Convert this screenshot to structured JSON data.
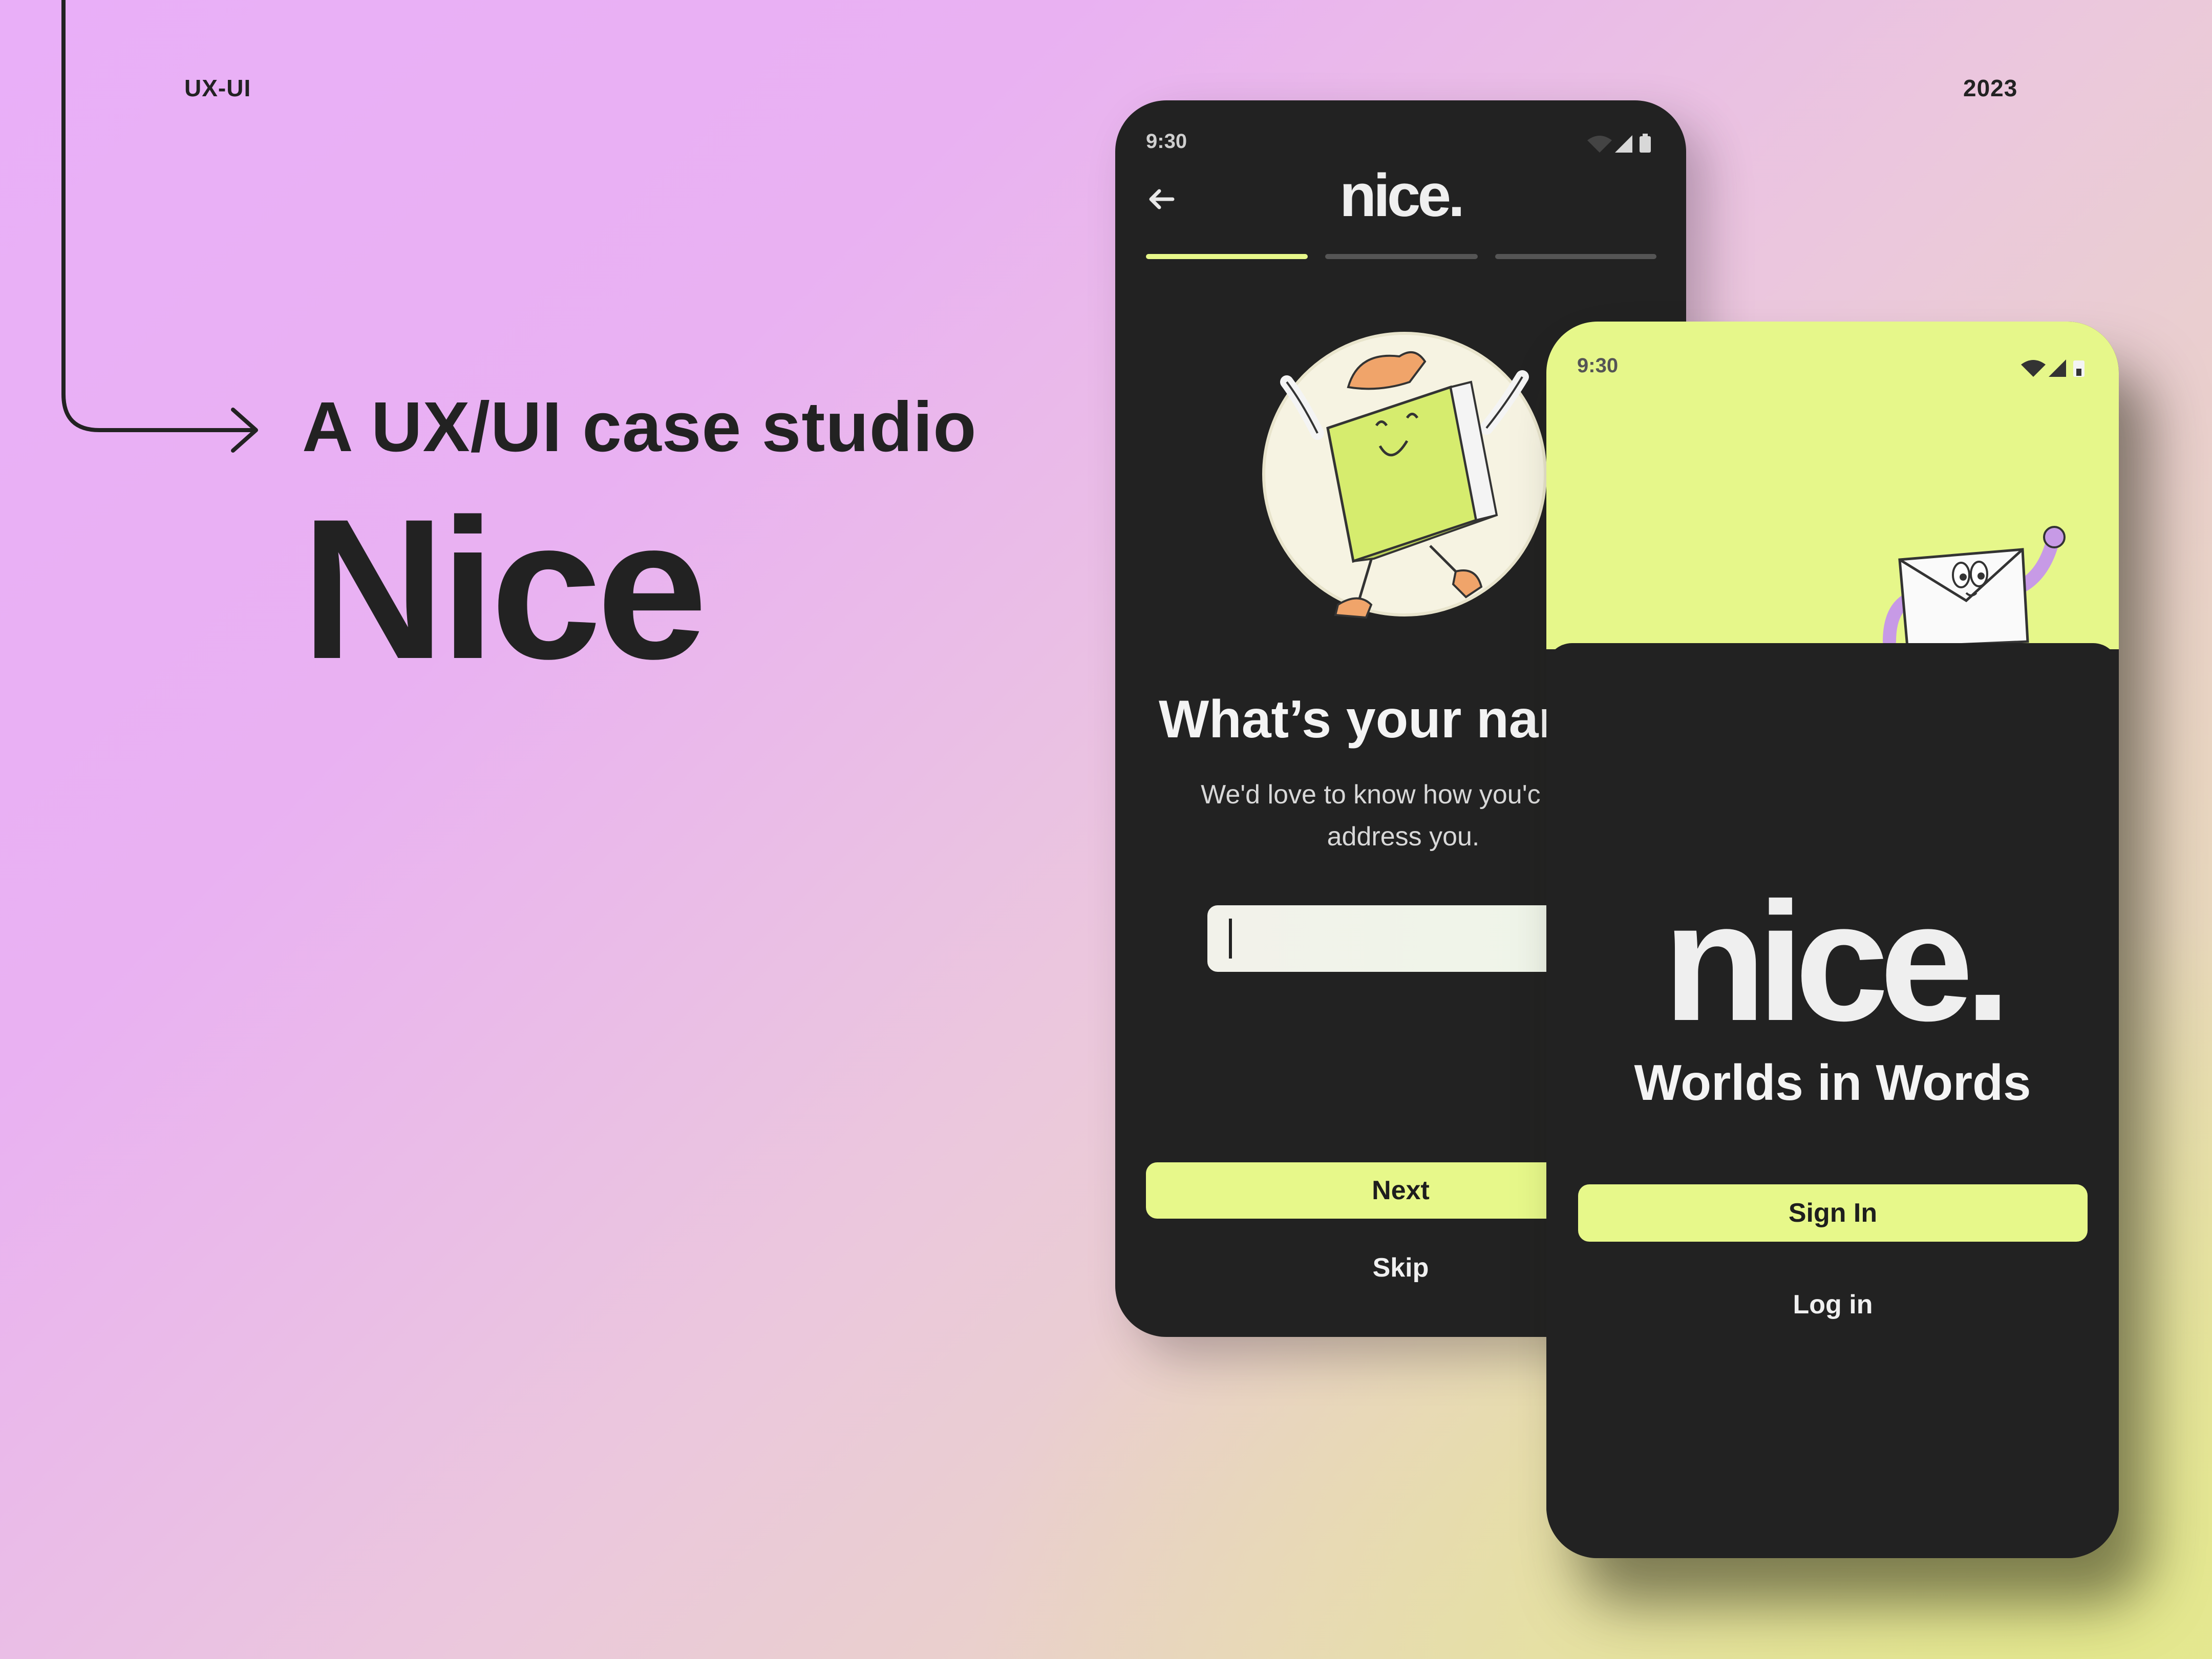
{
  "header": {
    "left_label": "UX-UI",
    "right_label": "2023"
  },
  "hero": {
    "subtitle": "A UX/UI case studio",
    "title": "Nice"
  },
  "colors": {
    "accent": "#e7f88a",
    "phone_bg": "#222222",
    "text_dark": "#222222"
  },
  "screen_name": {
    "status_time": "9:30",
    "back_icon": "arrow-left-icon",
    "logo": "nice.",
    "progress": {
      "current_step": 1,
      "total_steps": 3
    },
    "question": "What’s your nar",
    "description": "We'd love to know how you'c us to address you.",
    "input_value": "",
    "next_label": "Next",
    "skip_label": "Skip"
  },
  "screen_welcome": {
    "status_time": "9:30",
    "logo": "nice.",
    "tagline": "Worlds in Words",
    "signin_label": "Sign In",
    "login_label": "Log in"
  }
}
